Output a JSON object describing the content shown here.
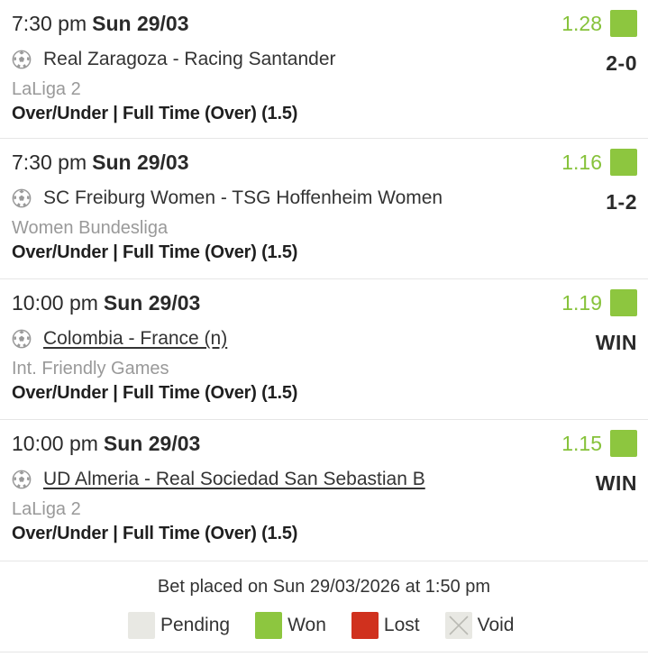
{
  "bets": [
    {
      "time": "7:30 pm",
      "date": "Sun 29/03",
      "odds": "1.28",
      "teams": "Real Zaragoza - Racing Santander",
      "linked": false,
      "result": "2-0",
      "league": "LaLiga 2",
      "market": "Over/Under | Full Time (Over) (1.5)",
      "status": "won"
    },
    {
      "time": "7:30 pm",
      "date": "Sun 29/03",
      "odds": "1.16",
      "teams": "SC Freiburg Women - TSG Hoffenheim Women",
      "linked": false,
      "result": "1-2",
      "league": "Women Bundesliga",
      "market": "Over/Under | Full Time (Over) (1.5)",
      "status": "won"
    },
    {
      "time": "10:00 pm",
      "date": "Sun 29/03",
      "odds": "1.19",
      "teams": "Colombia - France (n)",
      "linked": true,
      "result": "WIN",
      "league": "Int. Friendly Games",
      "market": "Over/Under | Full Time (Over) (1.5)",
      "status": "won"
    },
    {
      "time": "10:00 pm",
      "date": "Sun 29/03",
      "odds": "1.15",
      "teams": "UD Almeria - Real Sociedad San Sebastian B",
      "linked": true,
      "result": "WIN",
      "league": "LaLiga 2",
      "market": "Over/Under | Full Time (Over) (1.5)",
      "status": "won"
    }
  ],
  "icons": {
    "sport": "soccer-ball-icon",
    "void": "x-icon"
  },
  "colors": {
    "odds": "#86c23a",
    "won": "#8dc63f",
    "lost": "#d0311e",
    "pending": "#e8e8e3"
  },
  "footer": {
    "placed": "Bet placed on Sun 29/03/2026 at 1:50 pm",
    "legend": {
      "pending": "Pending",
      "won": "Won",
      "lost": "Lost",
      "void": "Void"
    }
  }
}
